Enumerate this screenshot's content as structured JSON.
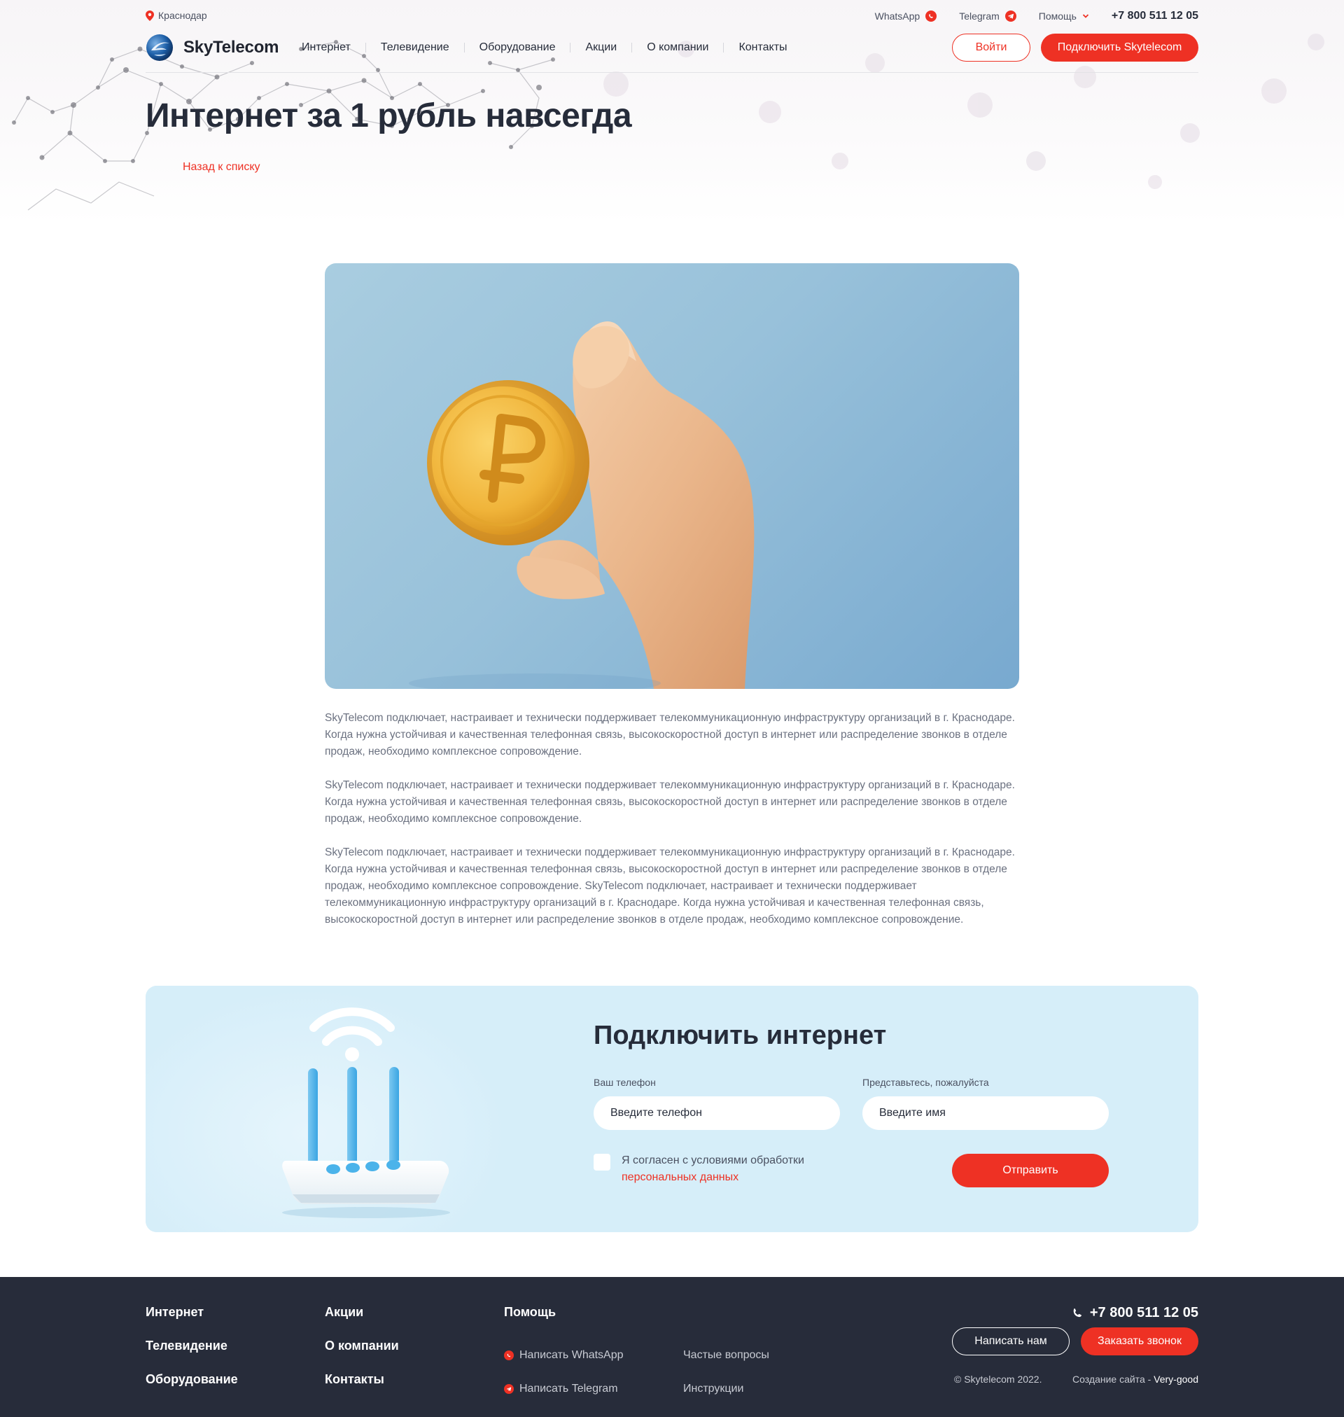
{
  "topbar": {
    "city": "Краснодар",
    "whatsapp": "WhatsApp",
    "telegram": "Telegram",
    "help": "Помощь",
    "phone": "+7 800 511 12 05"
  },
  "header": {
    "logo": "SkyTelecom",
    "nav": [
      "Интернет",
      "Телевидение",
      "Оборудование",
      "Акции",
      "О компании",
      "Контакты"
    ],
    "login_label": "Войти",
    "connect_label": "Подключить Skytelecom"
  },
  "page": {
    "title": "Интернет за 1 рубль навсегда",
    "back_label": "Назад к списку"
  },
  "article": {
    "paragraphs": [
      "SkyTelecom подключает, настраивает и технически поддерживает телекоммуникационную инфраструктуру организаций в г. Краснодаре. Когда нужна устойчивая и качественная телефонная связь, высокоскоростной доступ в интернет или распределение звонков в отделе продаж, необходимо комплексное сопровождение.",
      "SkyTelecom подключает, настраивает и технически поддерживает телекоммуникационную инфраструктуру организаций в г. Краснодаре. Когда нужна устойчивая и качественная телефонная связь, высокоскоростной доступ в интернет или распределение звонков в отделе продаж, необходимо комплексное сопровождение.",
      "SkyTelecom подключает, настраивает и технически поддерживает телекоммуникационную инфраструктуру организаций в г. Краснодаре. Когда нужна устойчивая и качественная телефонная связь, высокоскоростной доступ в интернет или распределение звонков в отделе продаж, необходимо комплексное сопровождение. SkyTelecom подключает, настраивает и технически поддерживает телекоммуникационную инфраструктуру организаций в г. Краснодаре. Когда нужна устойчивая и качественная телефонная связь, высокоскоростной доступ в интернет или распределение звонков в отделе продаж, необходимо комплексное сопровождение."
    ]
  },
  "connect": {
    "title": "Подключить интернет",
    "phone_label": "Ваш телефон",
    "phone_placeholder": "Введите телефон",
    "name_label": "Представьтесь, пожалуйста",
    "name_placeholder": "Введите имя",
    "consent_text": "Я согласен с условиями обработки",
    "consent_link": "персональных данных",
    "consent_checked": false,
    "submit_label": "Отправить"
  },
  "footer": {
    "col1": [
      "Интернет",
      "Телевидение",
      "Оборудование"
    ],
    "col2": [
      "Акции",
      "О компании",
      "Контакты"
    ],
    "help_title": "Помощь",
    "whatsapp_link": "Написать WhatsApp",
    "telegram_link": "Написать Telegram",
    "faq": "Частые вопросы",
    "instructions": "Инструкции",
    "phone": "+7 800 511 12 05",
    "write_label": "Написать нам",
    "call_label": "Заказать звонок",
    "copyright": "© Skytelecom 2022.",
    "credit_text": "Создание сайта -",
    "credit_name": "Very-good"
  },
  "colors": {
    "accent": "#ee3124",
    "dark": "#262c3a",
    "footer_bg": "#272c3a",
    "connect_bg": "#d6eef9"
  },
  "icons": {
    "city": "map-pin-icon",
    "whatsapp": "whatsapp-icon",
    "telegram": "telegram-icon",
    "help": "chevron-down-icon",
    "phone": "phone-icon"
  }
}
